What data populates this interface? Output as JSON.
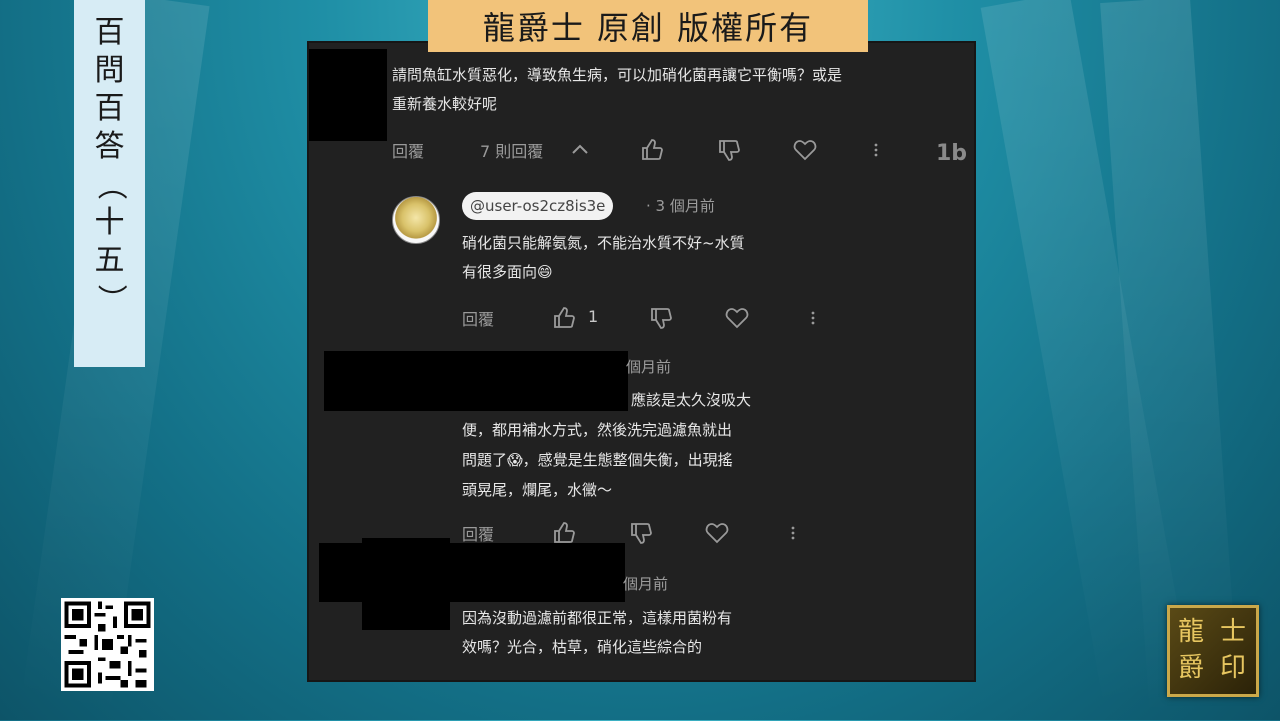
{
  "top_banner": "龍爵士 原創 版權所有",
  "side_banner": [
    "百",
    "問",
    "百",
    "答",
    "（",
    "十",
    "五",
    "）"
  ],
  "comments": {
    "main_text_line1": "請問魚缸水質惡化，導致魚生病，可以加硝化菌再讓它平衡嗎？或是",
    "main_text_line2": "重新養水較好呢",
    "reply_label": "回覆",
    "replies_count_label": "7 則回覆",
    "reply1": {
      "handle": "@user-os2cz8is3e",
      "time": "· 3 個月前",
      "line1": "硝化菌只能解氨氮，不能治水質不好~水質",
      "line2": "有很多面向😄",
      "reply_label": "回覆",
      "likes": "1"
    },
    "reply2": {
      "time_partial": "個月前",
      "line1": "應該是太久沒吸大",
      "line2": "便，都用補水方式，然後洗完過濾魚就出",
      "line3": "問題了😱，感覺是生態整個失衡，出現搖",
      "line4": "頭晃尾，爛尾，水黴～",
      "reply_label": "回覆"
    },
    "reply3": {
      "time_partial": "個月前",
      "line1": "因為沒動過濾前都很正常，這樣用菌粉有",
      "line2": "效嗎？光合，枯草，硝化這些綜合的"
    }
  },
  "seal_chars": [
    "龍",
    "爵",
    "士",
    "印"
  ],
  "colors": {
    "banner_yellow": "#f2c37a",
    "side_banner": "#d7ecf5",
    "panel_bg": "#212121"
  },
  "icons": [
    "thumb-up-icon",
    "thumb-down-icon",
    "heart-icon",
    "more-vert-icon",
    "chevron-up-icon",
    "qr-code-icon",
    "seal-icon"
  ]
}
